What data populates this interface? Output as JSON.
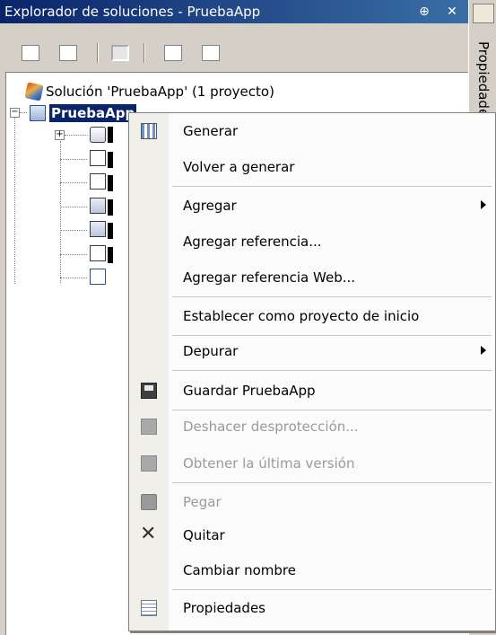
{
  "panel": {
    "title": "Explorador de soluciones - PruebaApp",
    "pin_glyph": "⊕",
    "close_glyph": "✕"
  },
  "toolbar": {
    "buttons": [
      "properties-icon",
      "show-all-files-icon",
      "refresh-icon",
      "view-code-icon",
      "view-designer-icon"
    ]
  },
  "tree": {
    "solution_label": "Solución 'PruebaApp' (1 proyecto)",
    "project_label": "PruebaApp"
  },
  "side_panel": {
    "label": "Propiedades"
  },
  "context_menu": {
    "items": [
      {
        "label": "Generar",
        "icon": "build-icon",
        "enabled": true,
        "submenu": false
      },
      {
        "label": "Volver a generar",
        "icon": "",
        "enabled": true,
        "submenu": false
      },
      {
        "label": "Agregar",
        "icon": "",
        "enabled": true,
        "submenu": true
      },
      {
        "label": "Agregar referencia...",
        "icon": "",
        "enabled": true,
        "submenu": false
      },
      {
        "label": "Agregar referencia Web...",
        "icon": "",
        "enabled": true,
        "submenu": false
      },
      {
        "label": "Establecer como proyecto de inicio",
        "icon": "",
        "enabled": true,
        "submenu": false
      },
      {
        "label": "Depurar",
        "icon": "",
        "enabled": true,
        "submenu": true
      },
      {
        "label": "Guardar PruebaApp",
        "icon": "save-icon",
        "enabled": true,
        "submenu": false
      },
      {
        "label": "Deshacer desprotección...",
        "icon": "undo-checkout-icon",
        "enabled": false,
        "submenu": false
      },
      {
        "label": "Obtener la última versión",
        "icon": "get-latest-icon",
        "enabled": false,
        "submenu": false
      },
      {
        "label": "Pegar",
        "icon": "paste-icon",
        "enabled": false,
        "submenu": false
      },
      {
        "label": "Quitar",
        "icon": "remove-icon",
        "enabled": true,
        "submenu": false
      },
      {
        "label": "Cambiar nombre",
        "icon": "",
        "enabled": true,
        "submenu": false
      },
      {
        "label": "Propiedades",
        "icon": "properties-icon",
        "enabled": true,
        "submenu": false
      }
    ]
  }
}
